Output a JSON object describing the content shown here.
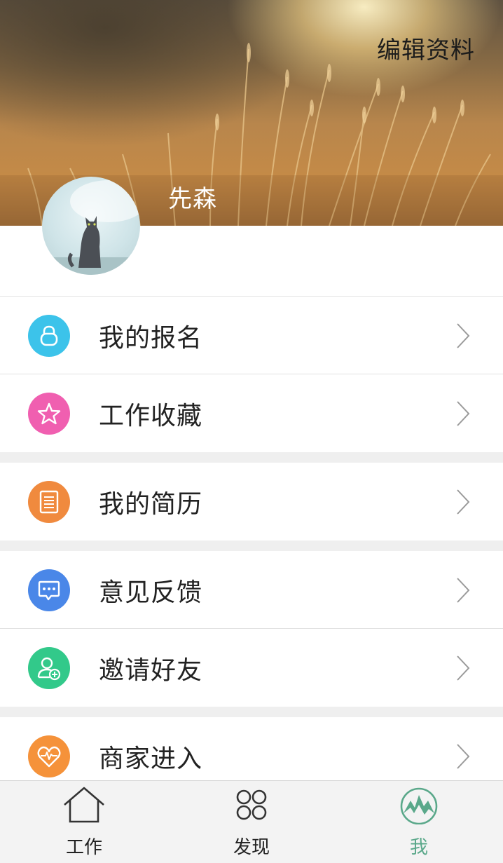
{
  "header": {
    "edit_label": "编辑资料",
    "username": "先森"
  },
  "menu_groups": [
    [
      {
        "label": "我的报名",
        "icon": "lock-icon",
        "color": "#3cc3ea"
      },
      {
        "label": "工作收藏",
        "icon": "star-icon",
        "color": "#f05fb0"
      }
    ],
    [
      {
        "label": "我的简历",
        "icon": "resume-icon",
        "color": "#f08a3e"
      }
    ],
    [
      {
        "label": "意见反馈",
        "icon": "chat-icon",
        "color": "#4a87e8"
      },
      {
        "label": "邀请好友",
        "icon": "add-user-icon",
        "color": "#32c98a"
      }
    ],
    [
      {
        "label": "商家进入",
        "icon": "heart-icon",
        "color": "#f5923a"
      }
    ]
  ],
  "tabbar": {
    "tabs": [
      {
        "label": "工作",
        "icon": "home-icon",
        "active": false
      },
      {
        "label": "发现",
        "icon": "grid-circles-icon",
        "active": false
      },
      {
        "label": "我",
        "icon": "profile-mountain-icon",
        "active": true
      }
    ],
    "active_color": "#5aa88a",
    "inactive_color": "#222222"
  }
}
